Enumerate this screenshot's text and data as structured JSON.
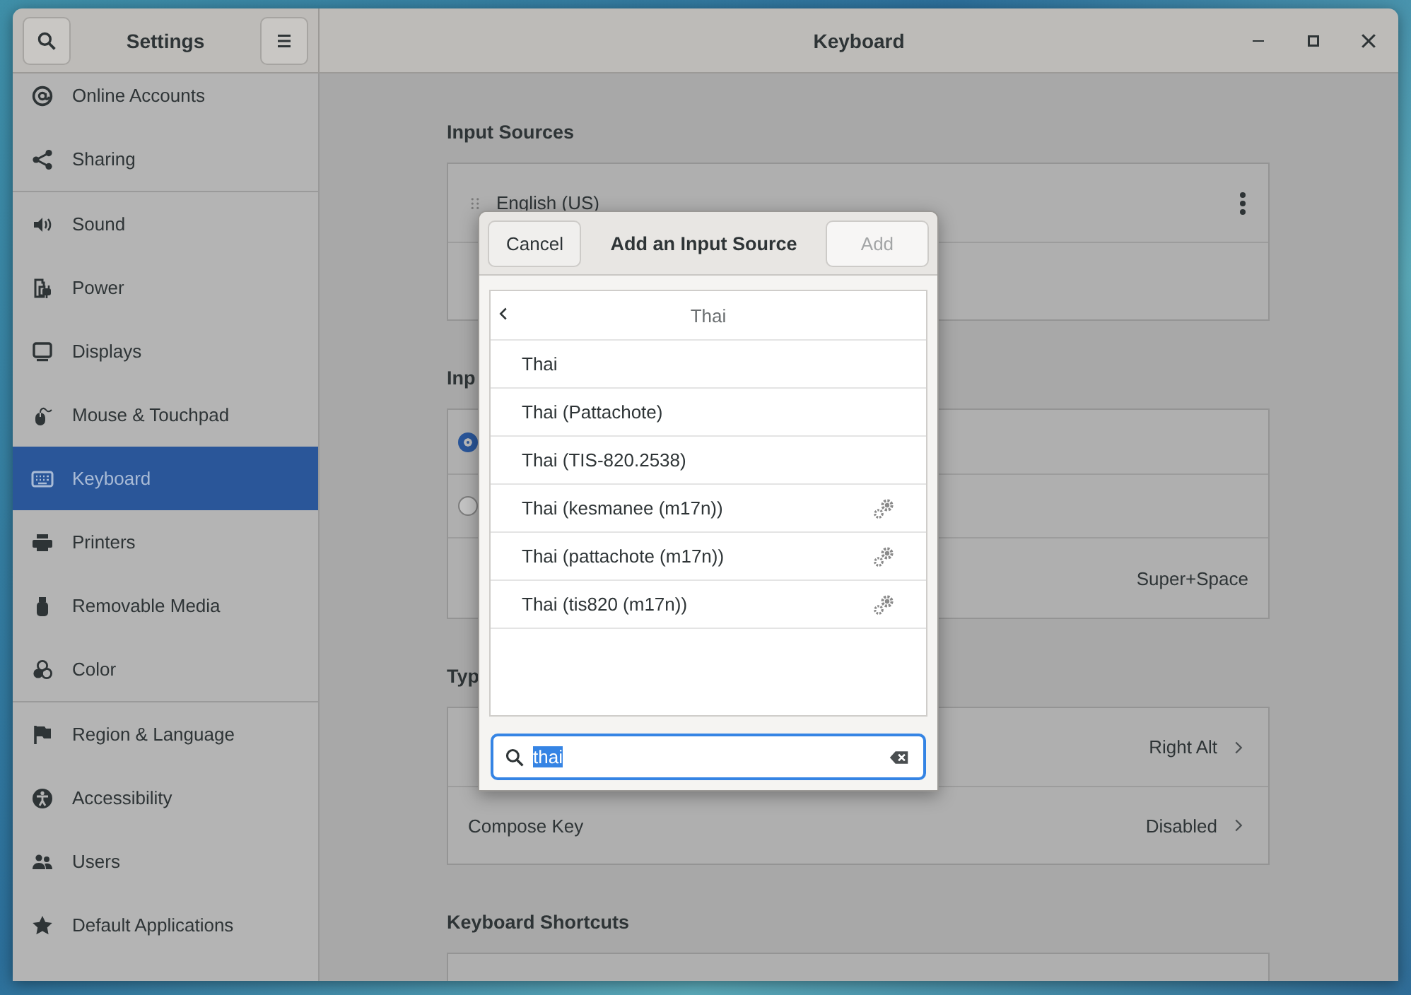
{
  "window": {
    "title": "Settings",
    "page_title": "Keyboard"
  },
  "sidebar": {
    "groups": [
      [
        {
          "label": "Online Accounts",
          "selected": false
        },
        {
          "label": "Sharing",
          "selected": false
        }
      ],
      [
        {
          "label": "Sound",
          "selected": false
        },
        {
          "label": "Power",
          "selected": false
        },
        {
          "label": "Displays",
          "selected": false
        },
        {
          "label": "Mouse & Touchpad",
          "selected": false
        },
        {
          "label": "Keyboard",
          "selected": true
        },
        {
          "label": "Printers",
          "selected": false
        },
        {
          "label": "Removable Media",
          "selected": false
        },
        {
          "label": "Color",
          "selected": false
        }
      ],
      [
        {
          "label": "Region & Language",
          "selected": false
        },
        {
          "label": "Accessibility",
          "selected": false
        },
        {
          "label": "Users",
          "selected": false
        },
        {
          "label": "Default Applications",
          "selected": false
        }
      ]
    ]
  },
  "sections": [
    {
      "title": "Input Sources",
      "rows": [
        {
          "kind": "source",
          "label": "English (US)"
        },
        {
          "kind": "blank"
        }
      ]
    },
    {
      "title": "Inp",
      "rows": [
        {
          "kind": "radio",
          "selected": true
        },
        {
          "kind": "radio",
          "selected": false
        },
        {
          "kind": "value",
          "value": "Super+Space"
        }
      ]
    },
    {
      "title": "Typ",
      "rows": [
        {
          "kind": "link",
          "value": "Right Alt"
        },
        {
          "kind": "link",
          "label": "Compose Key",
          "value": "Disabled"
        }
      ]
    },
    {
      "title": "Keyboard Shortcuts",
      "rows": [
        {
          "kind": "link"
        }
      ]
    }
  ],
  "dialog": {
    "title": "Add an Input Source",
    "cancel": "Cancel",
    "add": {
      "label": "Add",
      "disabled": true
    },
    "back_title": "Thai",
    "items": [
      {
        "label": "Thai",
        "configurable": false
      },
      {
        "label": "Thai (Pattachote)",
        "configurable": false
      },
      {
        "label": "Thai (TIS-820.2538)",
        "configurable": false
      },
      {
        "label": "Thai (kesmanee (m17n))",
        "configurable": true
      },
      {
        "label": "Thai (pattachote (m17n))",
        "configurable": true
      },
      {
        "label": "Thai (tis820 (m17n))",
        "configurable": true
      }
    ],
    "search": {
      "value": "thai"
    }
  }
}
